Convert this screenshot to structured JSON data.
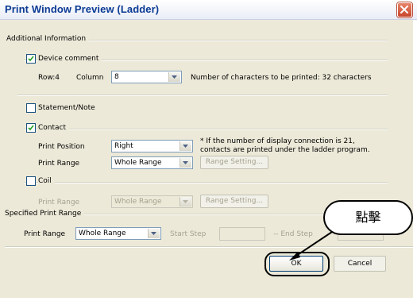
{
  "window": {
    "title": "Print Window Preview (Ladder)",
    "close_icon": "close-icon"
  },
  "additional_info": {
    "group_label": "Additional Information",
    "device_comment": {
      "label": "Device comment",
      "checked": true
    },
    "row_label": "Row:4",
    "column_label": "Column",
    "column_value": "8",
    "chars_note": "Number of characters to be printed: 32 characters",
    "statement_note": {
      "label": "Statement/Note",
      "checked": false
    },
    "contact": {
      "label": "Contact",
      "checked": true
    },
    "print_position_label": "Print Position",
    "print_position_value": "Right",
    "connection_note_line1": "* If the number of display connection is 21,",
    "connection_note_line2": "contacts are printed under the ladder program.",
    "contact_print_range_label": "Print Range",
    "contact_print_range_value": "Whole Range",
    "contact_range_setting": "Range Setting...",
    "coil": {
      "label": "Coil",
      "checked": false
    },
    "coil_print_range_label": "Print Range",
    "coil_print_range_value": "Whole Range",
    "coil_range_setting": "Range Setting..."
  },
  "specified_range": {
    "group_label": "Specified Print Range",
    "print_range_label": "Print Range",
    "print_range_value": "Whole Range",
    "start_step_label": "Start Step",
    "end_step_label": "-- End Step",
    "start_step_value": "",
    "end_step_value": ""
  },
  "buttons": {
    "ok": "OK",
    "cancel": "Cancel"
  },
  "annotation": {
    "callout_text": "點擊"
  },
  "colors": {
    "title_text": "#0b3a93",
    "dialog_bg": "#ece9d8",
    "close_button": "#d2532f"
  }
}
